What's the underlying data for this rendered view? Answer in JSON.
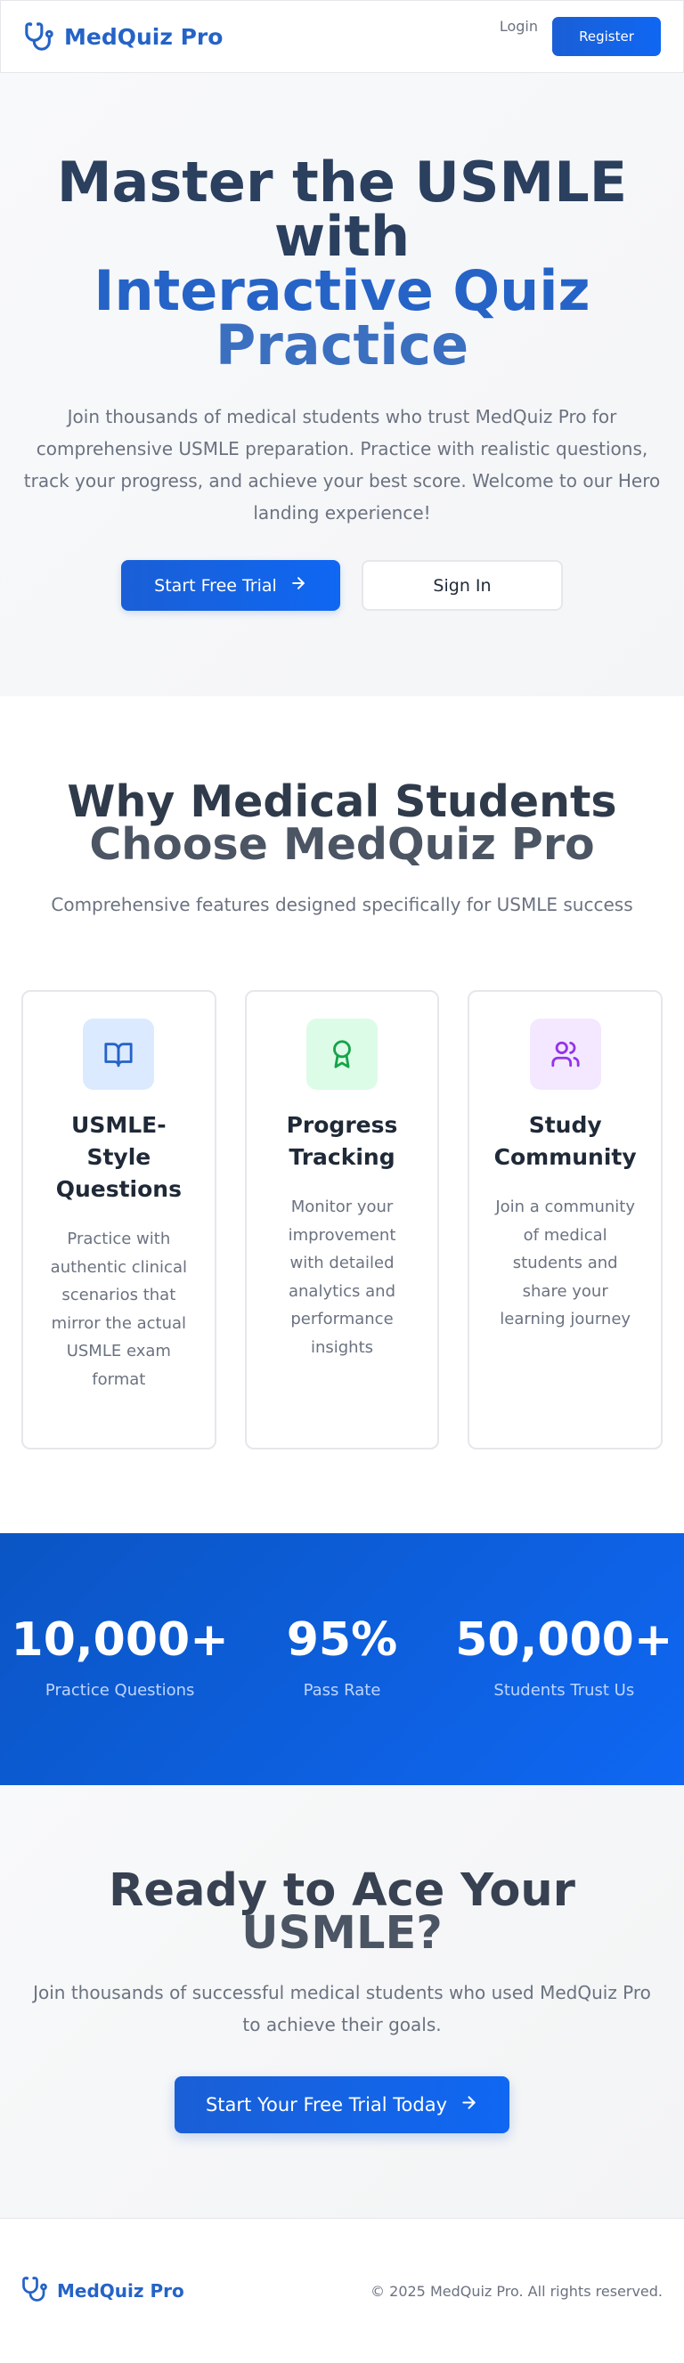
{
  "header": {
    "brand": "MedQuiz Pro",
    "brand_icon": "stethoscope-icon",
    "login_label": "Login",
    "register_label": "Register"
  },
  "hero": {
    "title_line1": "Master the USMLE",
    "title_line2": "with",
    "title_line3": "Interactive Quiz",
    "title_line4": "Practice",
    "subtitle": "Join thousands of medical students who trust MedQuiz Pro for comprehensive USMLE preparation. Practice with realistic questions, track your progress, and achieve your best score. Welcome to our Hero landing experience!",
    "primary_button": "Start Free Trial",
    "primary_button_icon": "arrow-right-icon",
    "secondary_button": "Sign In"
  },
  "features": {
    "title_line1": "Why Medical Students",
    "title_line2": "Choose MedQuiz Pro",
    "subtitle": "Comprehensive features designed specifically for USMLE success",
    "cards": [
      {
        "icon": "book-open-icon",
        "icon_bg": "#dbeafe",
        "icon_color": "#2563c7",
        "title": "USMLE-Style Questions",
        "text": "Practice with authentic clinical scenarios that mirror the actual USMLE exam format"
      },
      {
        "icon": "award-icon",
        "icon_bg": "#dcfce7",
        "icon_color": "#16a34a",
        "title": "Progress Tracking",
        "text": "Monitor your improvement with detailed analytics and performance insights"
      },
      {
        "icon": "users-icon",
        "icon_bg": "#f3e8ff",
        "icon_color": "#9333ea",
        "title": "Study Community",
        "text": "Join a community of medical students and share your learning journey"
      }
    ]
  },
  "stats": [
    {
      "value": "10,000+",
      "label": "Practice Questions"
    },
    {
      "value": "95%",
      "label": "Pass Rate"
    },
    {
      "value": "50,000+",
      "label": "Students Trust Us"
    }
  ],
  "cta": {
    "title_line1": "Ready to Ace Your",
    "title_line2": "USMLE?",
    "subtitle": "Join thousands of successful medical students who used MedQuiz Pro to achieve their goals.",
    "button": "Start Your Free Trial Today",
    "button_icon": "arrow-right-icon"
  },
  "footer": {
    "brand": "MedQuiz Pro",
    "copyright": "© 2025 MedQuiz Pro. All rights reserved."
  },
  "colors": {
    "brand": "#2563c7",
    "primary_button": "#1266e8",
    "stats_bg": "#0b5cd8"
  }
}
